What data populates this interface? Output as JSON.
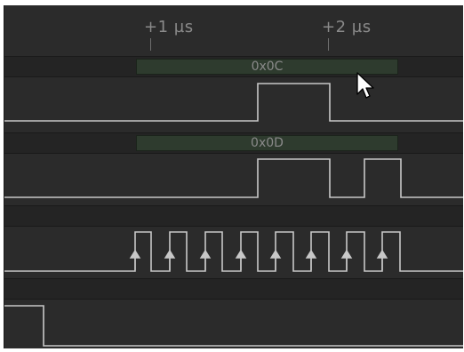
{
  "ruler": {
    "ticks": [
      {
        "label": "+1 µs"
      },
      {
        "label": "+2 µs"
      }
    ]
  },
  "decoders": [
    {
      "value": "0x0C"
    },
    {
      "value": "0x0D"
    }
  ],
  "colors": {
    "background": "#2b2b2b",
    "band": "#242424",
    "decode_fill": "#2e3b2e",
    "trace": "#c8c8c8",
    "label": "#8a8a8a"
  },
  "icons": {
    "pointer": "mouse-pointer-icon",
    "clock_edge": "rising-edge-arrow-icon"
  }
}
